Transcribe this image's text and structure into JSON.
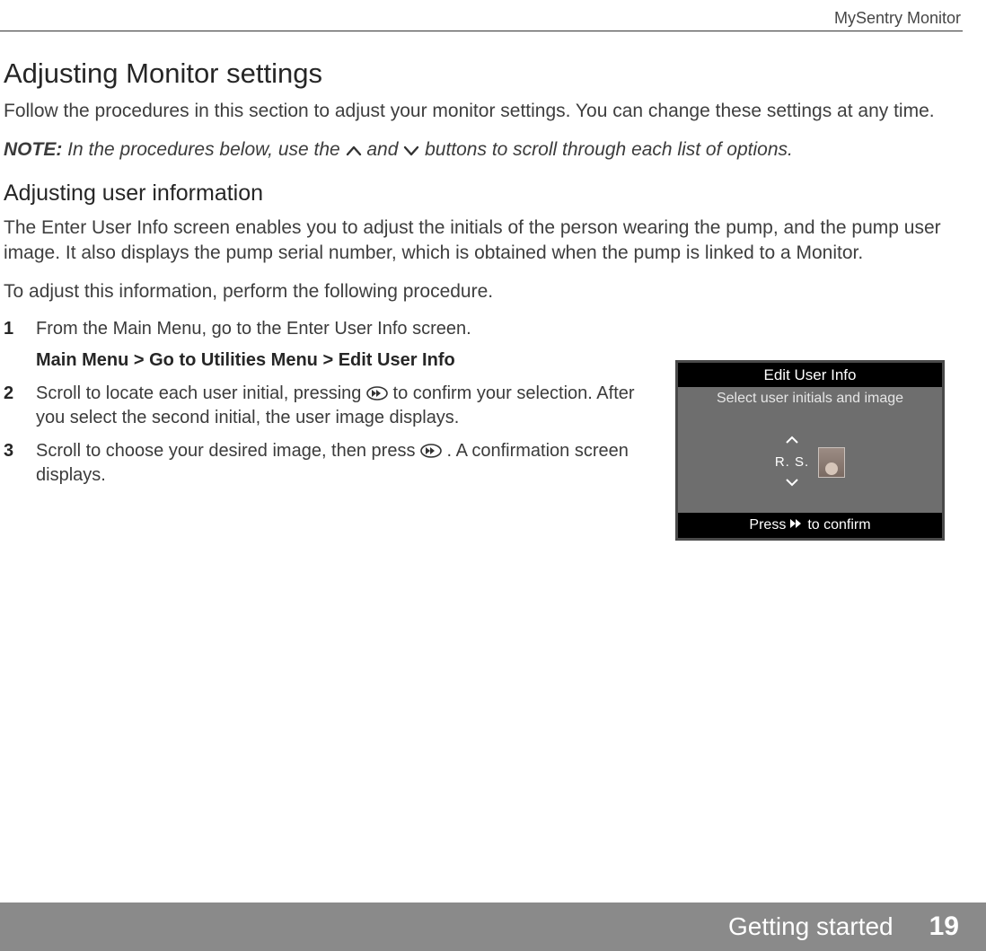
{
  "header": {
    "product_name": "MySentry Monitor"
  },
  "section": {
    "title": "Adjusting Monitor settings",
    "intro": "Follow the procedures in this section to adjust your monitor settings. You can change these settings at any time.",
    "note_label": "NOTE:",
    "note_before_up": " In the procedures below, use the ",
    "note_between": " and ",
    "note_after_down": " buttons to scroll through each list of options."
  },
  "subsection": {
    "title": "Adjusting user information",
    "lead": "The Enter User Info screen enables you to adjust the initials of the person wearing the pump, and the pump user image. It also displays the pump serial number, which is obtained when the pump is linked to a Monitor.",
    "procedure_intro": "To adjust this information, perform the following procedure."
  },
  "steps": {
    "s1_text": "From the Main Menu, go to the Enter User Info screen.",
    "s1_path": "Main Menu > Go to Utilities Menu > Edit User Info",
    "s2_before": "Scroll to locate each user initial, pressing ",
    "s2_after": " to confirm your selection. After you select the second initial, the user image displays.",
    "s3_before": "Scroll to choose your desired image, then press ",
    "s3_after": " . A confirmation screen displays."
  },
  "device": {
    "title": "Edit User Info",
    "subtitle": "Select user initials and image",
    "initials": "R. S.",
    "footer_before": "Press ",
    "footer_after": " to confirm"
  },
  "footer": {
    "section_name": "Getting started",
    "page_number": "19"
  }
}
